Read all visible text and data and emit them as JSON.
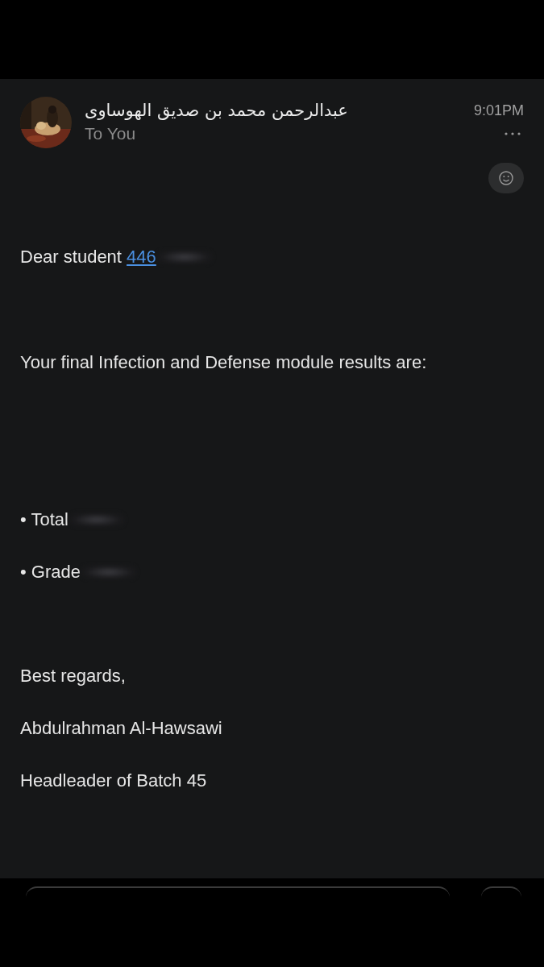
{
  "sender": {
    "name": "عبدالرحمن محمد بن صديق الهوساوى",
    "recipient": "To You",
    "time": "9:01PM"
  },
  "body": [
    {
      "kind": "greeting",
      "text": "Dear student ",
      "link": "446",
      "redacted": true
    },
    {
      "kind": "line",
      "text": "Your final Infection and Defense module results are:",
      "redacted": false
    },
    {
      "kind": "bullet",
      "text": "• Total",
      "redacted": true
    },
    {
      "kind": "bullet",
      "text": "• Grade",
      "redacted": true
    },
    {
      "kind": "line",
      "text": "Best regards,",
      "redacted": false
    },
    {
      "kind": "line",
      "text": "Abdulrahman Al-Hawsawi",
      "redacted": false
    },
    {
      "kind": "line",
      "text": "Headleader of Batch 45",
      "redacted": false
    }
  ]
}
